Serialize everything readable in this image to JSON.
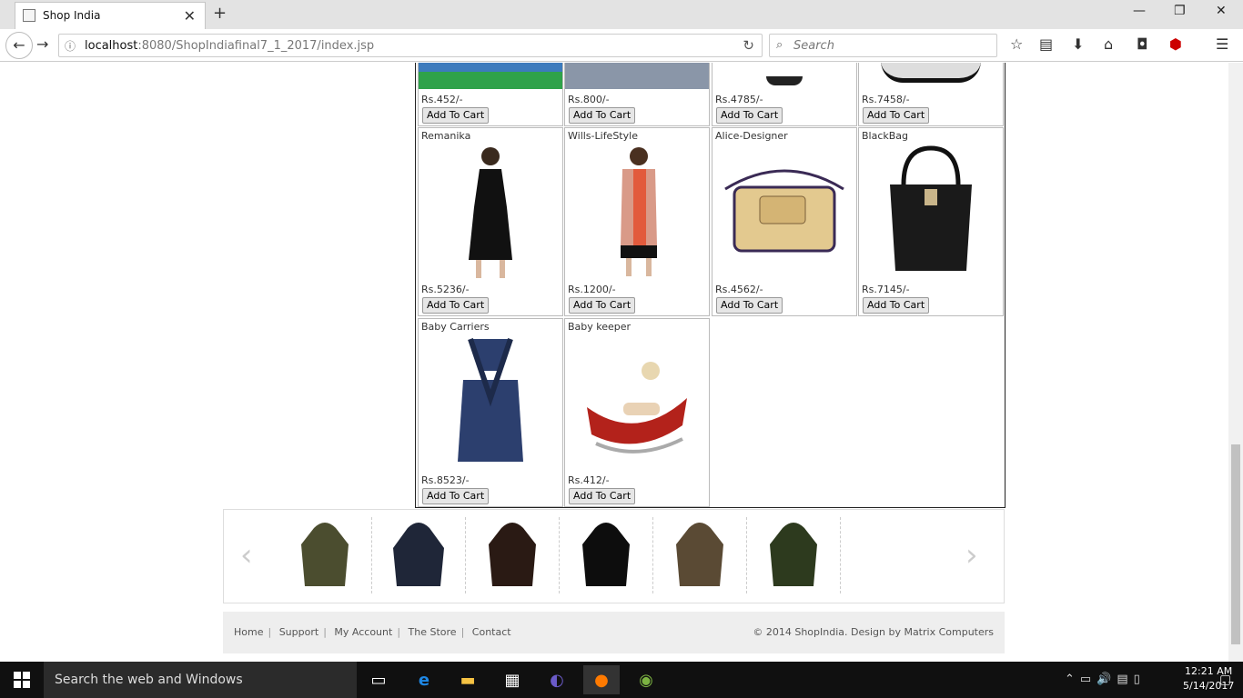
{
  "browser": {
    "tab_title": "Shop India",
    "url_host": "localhost",
    "url_rest": ":8080/ShopIndiafinal7_1_2017/index.jsp",
    "search_placeholder": "Search"
  },
  "top_row": [
    {
      "price": "Rs.452/-",
      "button": "Add To Cart"
    },
    {
      "price": "Rs.800/-",
      "button": "Add To Cart"
    },
    {
      "price": "Rs.4785/-",
      "button": "Add To Cart"
    },
    {
      "price": "Rs.7458/-",
      "button": "Add To Cart"
    }
  ],
  "products": [
    {
      "name": "Remanika",
      "price": "Rs.5236/-",
      "button": "Add To Cart",
      "icon": "black-dress"
    },
    {
      "name": "Wills-LifeStyle",
      "price": "Rs.1200/-",
      "button": "Add To Cart",
      "icon": "orange-dress"
    },
    {
      "name": "Alice-Designer",
      "price": "Rs.4562/-",
      "button": "Add To Cart",
      "icon": "tan-handbag"
    },
    {
      "name": "BlackBag",
      "price": "Rs.7145/-",
      "button": "Add To Cart",
      "icon": "black-tote-bag"
    },
    {
      "name": "Baby Carriers",
      "price": "Rs.8523/-",
      "button": "Add To Cart",
      "icon": "blue-baby-carrier"
    },
    {
      "name": "Baby keeper",
      "price": "Rs.412/-",
      "button": "Add To Cart",
      "icon": "red-baby-rocker"
    }
  ],
  "carousel": {
    "items": [
      "olive-parka",
      "navy-puffer",
      "brown-fur-jacket",
      "black-puffer",
      "tan-jacket",
      "green-parka"
    ]
  },
  "footer": {
    "links": [
      "Home",
      "Support",
      "My Account",
      "The Store",
      "Contact"
    ],
    "copyright": "© 2014 ShopIndia. Design by Matrix Computers"
  },
  "taskbar": {
    "search_text": "Search the web and Windows",
    "time": "12:21 AM",
    "date": "5/14/2017"
  }
}
